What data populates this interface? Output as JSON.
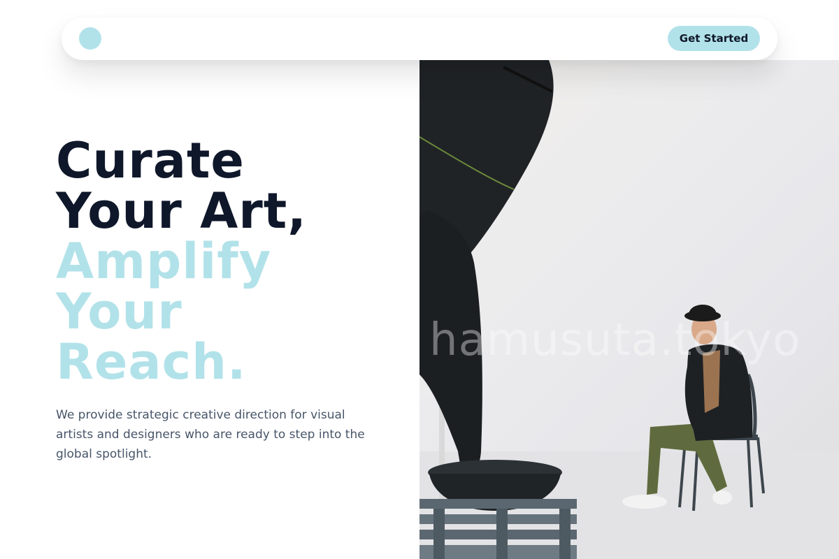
{
  "nav": {
    "logo": "logo-dot",
    "cta_label": "Get Started"
  },
  "hero": {
    "headline_lines": [
      "Curate",
      "Your Art,"
    ],
    "accent_lines": [
      "Amplify",
      "Your",
      "Reach."
    ],
    "subtext": "We provide strategic creative direction for visual artists and designers who are ready to step into the global spotlight."
  },
  "photo": {
    "watermark": "hamusuta.tokyo"
  },
  "colors": {
    "accent": "#b2e2e9",
    "heading": "#0f172a",
    "body": "#475569",
    "background": "#ffffff"
  }
}
